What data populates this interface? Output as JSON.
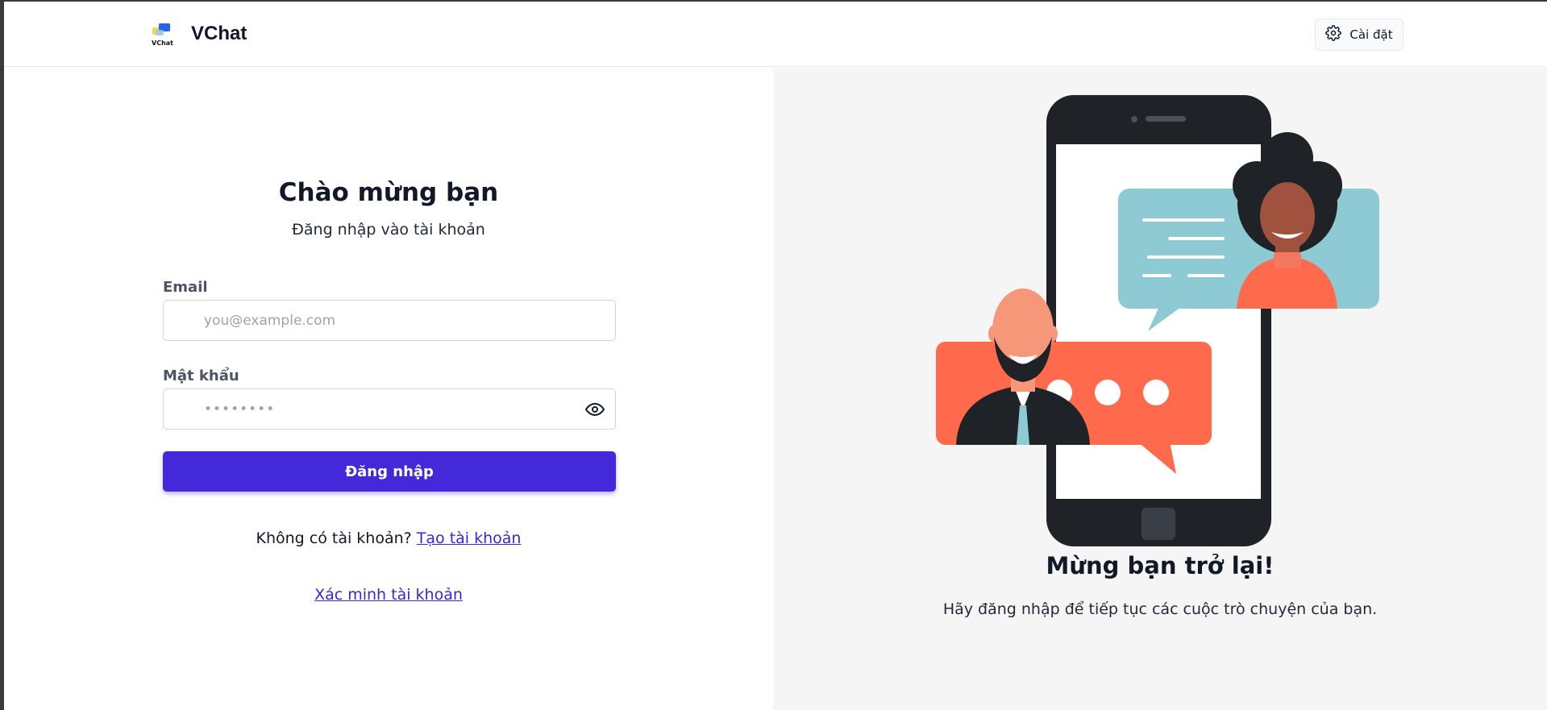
{
  "header": {
    "brand": "VChat",
    "logo_text": "VChat",
    "settings_label": "Cài đặt",
    "settings_icon": "gear-icon"
  },
  "login": {
    "title": "Chào mừng bạn",
    "subtitle": "Đăng nhập vào tài khoản",
    "email_label": "Email",
    "email_placeholder": "you@example.com",
    "email_value": "",
    "password_label": "Mật khẩu",
    "password_placeholder": "••••••••",
    "password_value": "",
    "show_password_icon": "eye-icon",
    "submit_label": "Đăng nhập",
    "no_account_text": "Không có tài khoản?",
    "create_account_link": "Tạo tài khoản",
    "verify_account_link": "Xác minh tài khoản"
  },
  "promo": {
    "title": "Mừng bạn trở lại!",
    "subtitle": "Hãy đăng nhập để tiếp tục các cuộc trò chuyện của bạn."
  },
  "colors": {
    "primary": "#4329d9",
    "link": "#3b26d6",
    "right_panel_bg": "#f5f5f5",
    "phone": "#1f2227",
    "bubble_teal": "#8ecad3",
    "bubble_coral": "#ff6a4d"
  }
}
